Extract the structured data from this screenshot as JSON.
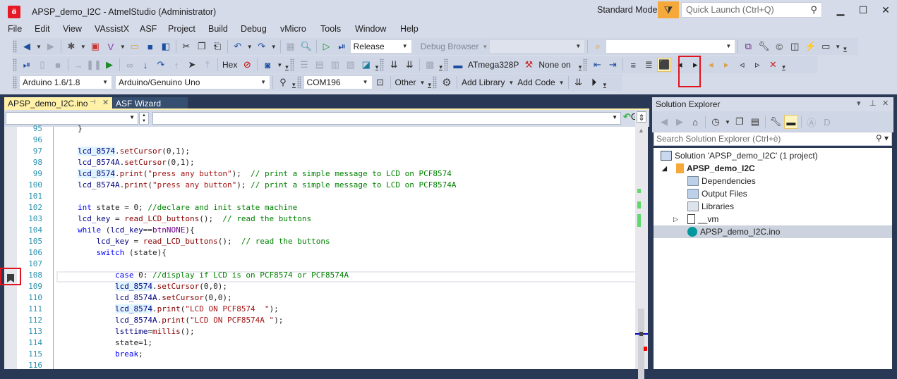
{
  "window": {
    "title": "APSP_demo_I2C - AtmelStudio (Administrator)",
    "mode": "Standard Mode",
    "quick_launch_placeholder": "Quick Launch (Ctrl+Q)",
    "minimize": "▁",
    "maximize": "☐",
    "close": "✕"
  },
  "menu": [
    "File",
    "Edit",
    "View",
    "VAssistX",
    "ASF",
    "Project",
    "Build",
    "Debug",
    "vMicro",
    "Tools",
    "Window",
    "Help"
  ],
  "toolbar": {
    "configuration": "Release",
    "debug_browser": "Debug Browser",
    "hex_label": "Hex",
    "device": "ATmega328P",
    "tool": "None on",
    "arduino_version": "Arduino 1.6/1.8",
    "board": "Arduino/Genuino Uno",
    "port": "COM196",
    "other": "Other",
    "add_library": "Add Library",
    "add_code": "Add Code",
    "dropdown_arrow": "▼",
    "overflow": "▾"
  },
  "tabs": {
    "active": "APSP_demo_I2C.ino",
    "pin": "⊣",
    "close": "✕",
    "inactive": "ASF Wizard"
  },
  "nav": {
    "go": "Go"
  },
  "editor": {
    "lines": [
      {
        "n": "95",
        "html": "}"
      },
      {
        "n": "96",
        "html": ""
      },
      {
        "n": "97",
        "html": "<span class=\"ref var\">lcd_8574</span>.<span class=\"fn\">setCursor</span>(0,1);"
      },
      {
        "n": "98",
        "html": "<span class=\"var\">lcd_8574A</span>.<span class=\"fn\">setCursor</span>(0,1);"
      },
      {
        "n": "99",
        "html": "<span class=\"ref var\">lcd_8574</span>.<span class=\"fn\">print</span>(<span class=\"str\">\"press any button\"</span>);  <span class=\"cmt\">// print a simple message to LCD on PCF8574</span>"
      },
      {
        "n": "100",
        "html": "<span class=\"var\">lcd_8574A</span>.<span class=\"fn\">print</span>(<span class=\"str\">\"press any button\"</span>); <span class=\"cmt\">// print a simple message to LCD on PCF8574A</span>"
      },
      {
        "n": "101",
        "html": ""
      },
      {
        "n": "102",
        "html": "<span class=\"kw\">int</span> state = 0; <span class=\"cmt\">//declare and init state machine</span>"
      },
      {
        "n": "103",
        "html": "<span class=\"var\">lcd_key</span> = <span class=\"fn\">read_LCD_buttons</span>();  <span class=\"cmt\">// read the buttons</span>"
      },
      {
        "n": "104",
        "html": "<span class=\"kw\">while</span> (<span class=\"var\">lcd_key</span>==<span class=\"mac\">btnNONE</span>){"
      },
      {
        "n": "105",
        "html": "    <span class=\"var\">lcd_key</span> = <span class=\"fn\">read_LCD_buttons</span>();  <span class=\"cmt\">// read the buttons</span>"
      },
      {
        "n": "106",
        "html": "    <span class=\"kw\">switch</span> (state){"
      },
      {
        "n": "107",
        "html": ""
      },
      {
        "n": "108",
        "html": "        <span class=\"kw\">case</span> 0: <span class=\"cmt\">//display if LCD is on PCF8574 or PCF8574A</span>"
      },
      {
        "n": "109",
        "html": "        <span class=\"ref var\">lcd_8574</span>.<span class=\"fn\">setCursor</span>(0,0);"
      },
      {
        "n": "110",
        "html": "        <span class=\"var\">lcd_8574A</span>.<span class=\"fn\">setCursor</span>(0,0);"
      },
      {
        "n": "111",
        "html": "        <span class=\"ref var\">lcd_8574</span>.<span class=\"fn\">print</span>(<span class=\"str\">\"LCD ON PCF8574  \"</span>);"
      },
      {
        "n": "112",
        "html": "        <span class=\"var\">lcd_8574A</span>.<span class=\"fn\">print</span>(<span class=\"str\">\"LCD ON PCF8574A \"</span>);"
      },
      {
        "n": "113",
        "html": "        <span class=\"var\">lsttime</span>=<span class=\"fn\">millis</span>();"
      },
      {
        "n": "114",
        "html": "        state=1;"
      },
      {
        "n": "115",
        "html": "        <span class=\"kw\">break</span>;"
      },
      {
        "n": "116",
        "html": ""
      }
    ]
  },
  "solution_explorer": {
    "title": "Solution Explorer",
    "search_placeholder": "Search Solution Explorer (Ctrl+è)",
    "tree": [
      {
        "label": "Solution 'APSP_demo_I2C' (1 project)",
        "bold": false
      },
      {
        "label": "APSP_demo_I2C",
        "bold": true
      },
      {
        "label": "Dependencies",
        "bold": false
      },
      {
        "label": "Output Files",
        "bold": false
      },
      {
        "label": "Libraries",
        "bold": false
      },
      {
        "label": "__vm",
        "bold": false
      },
      {
        "label": "APSP_demo_I2C.ino",
        "bold": false,
        "selected": true
      }
    ]
  },
  "colors": {
    "accent_highlight": "#e0141e",
    "tab_active": "#fff1a8",
    "filter": "#f5a93a"
  }
}
